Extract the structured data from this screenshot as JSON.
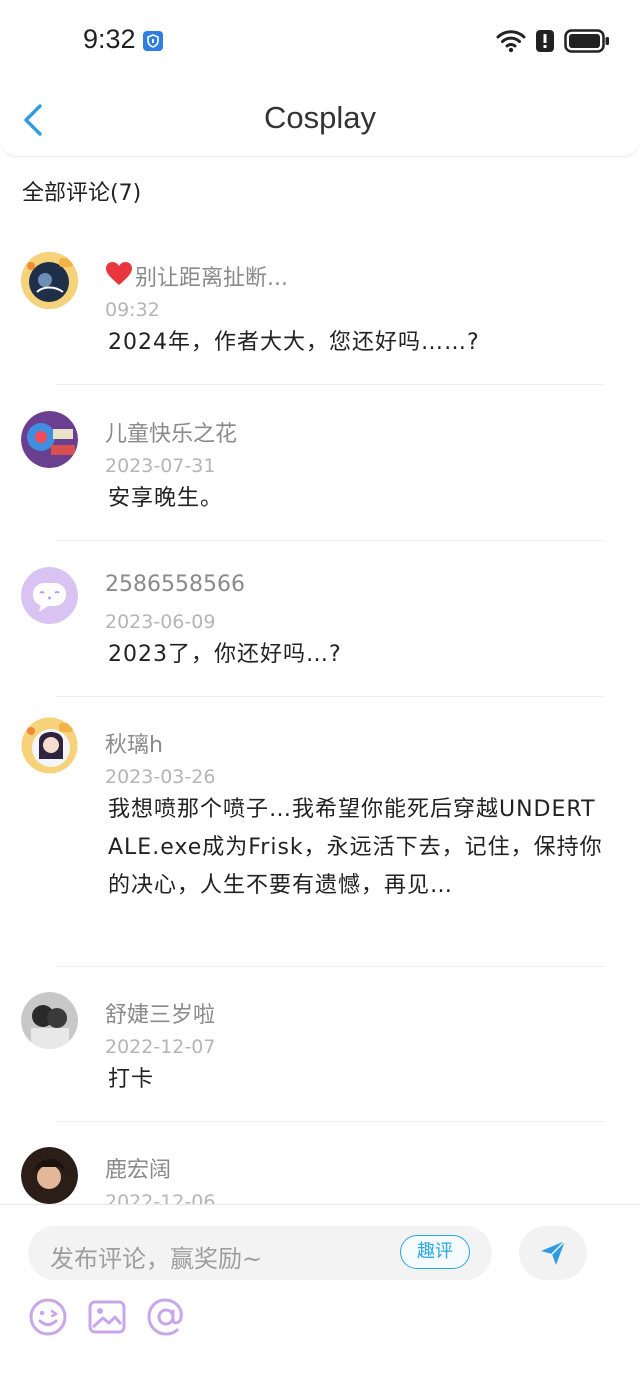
{
  "status_bar": {
    "time": "9:32"
  },
  "header": {
    "title": "Cosplay"
  },
  "section": {
    "title": "全部评论(7)"
  },
  "comments": [
    {
      "author": "别让距离扯断...",
      "author_badge": "heart-icon",
      "date": "09:32",
      "text": "2024年，作者大大，您还好吗……?"
    },
    {
      "author": "儿童快乐之花",
      "date": "2023-07-31",
      "text": "安享晚生。"
    },
    {
      "author": "2586558566",
      "date": "2023-06-09",
      "text": "2023了，你还好吗…?"
    },
    {
      "author": "秋璃h",
      "date": "2023-03-26",
      "text": "我想喷那个喷子…我希望你能死后穿越UNDERTALE.exe成为Frisk，永远活下去，记住，保持你的决心，人生不要有遗憾，再见…"
    },
    {
      "author": "舒婕三岁啦",
      "date": "2022-12-07",
      "text": "打卡"
    },
    {
      "author": "鹿宏阔",
      "date": "2022-12-06",
      "text": ""
    }
  ],
  "composer": {
    "placeholder": "发布评论，赢奖励~",
    "fun_comment_label": "趣评",
    "send_icon": "send-icon",
    "tools": [
      "emoji-icon",
      "image-icon",
      "mention-icon"
    ]
  },
  "colors": {
    "accent": "#29a8e3",
    "tool_icons": "#c9a6ea",
    "heart": "#e8383d"
  }
}
